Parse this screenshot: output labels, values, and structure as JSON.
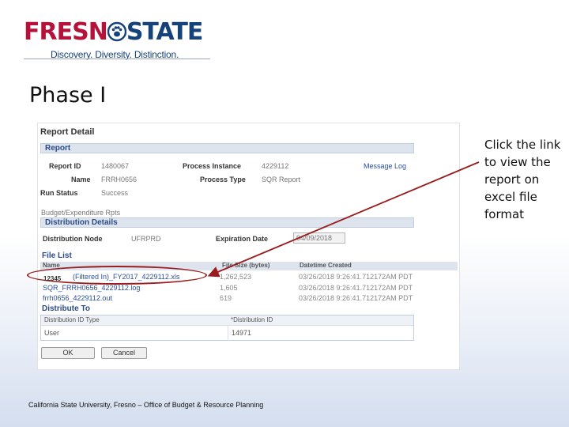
{
  "logo": {
    "word_left": "FRESN",
    "word_right": "STATE",
    "tagline": "Discovery. Diversity. Distinction."
  },
  "slide": {
    "title": "Phase I",
    "callout": "Click the link to view the report on excel file format",
    "id_label": "12345",
    "footer": "California State University, Fresno – Office of Budget & Resource Planning"
  },
  "report_detail": {
    "heading": "Report Detail",
    "report_section": "Report",
    "report_id_label": "Report ID",
    "report_id": "1480067",
    "process_instance_label": "Process Instance",
    "process_instance": "4229112",
    "message_log_link": "Message Log",
    "name_label": "Name",
    "name": "FRRH0656",
    "process_type_label": "Process Type",
    "process_type": "SQR Report",
    "run_status_label": "Run Status",
    "run_status": "Success",
    "description": "Budget/Expenditure Rpts",
    "distribution_section": "Distribution Details",
    "distribution_node_label": "Distribution Node",
    "distribution_node": "UFRPRD",
    "expiration_date_label": "Expiration Date",
    "expiration_date": "04/09/2018",
    "file_list_section": "File List",
    "file_list": {
      "columns": [
        "Name",
        "File Size (bytes)",
        "Datetime Created"
      ],
      "rows": [
        {
          "name": "(Filtered In)_FY2017_4229112.xls",
          "size": "1,262,523",
          "datetime": "03/26/2018  9:26:41.712172AM PDT"
        },
        {
          "name": "SQR_FRRH0656_4229112.log",
          "size": "1,605",
          "datetime": "03/26/2018  9:26:41.712172AM PDT"
        },
        {
          "name": "frrh0656_4229112.out",
          "size": "619",
          "datetime": "03/26/2018  9:26:41.712172AM PDT"
        }
      ]
    },
    "distribute_to_section": "Distribute To",
    "distribute_to": {
      "columns": [
        "Distribution ID Type",
        "*Distribution ID"
      ],
      "row": {
        "type": "User",
        "id": "14971"
      }
    },
    "ok_button": "OK",
    "cancel_button": "Cancel"
  },
  "colors": {
    "brand_red": "#b5123a",
    "brand_blue": "#16427a",
    "annotation_red": "#9a1c1c"
  }
}
